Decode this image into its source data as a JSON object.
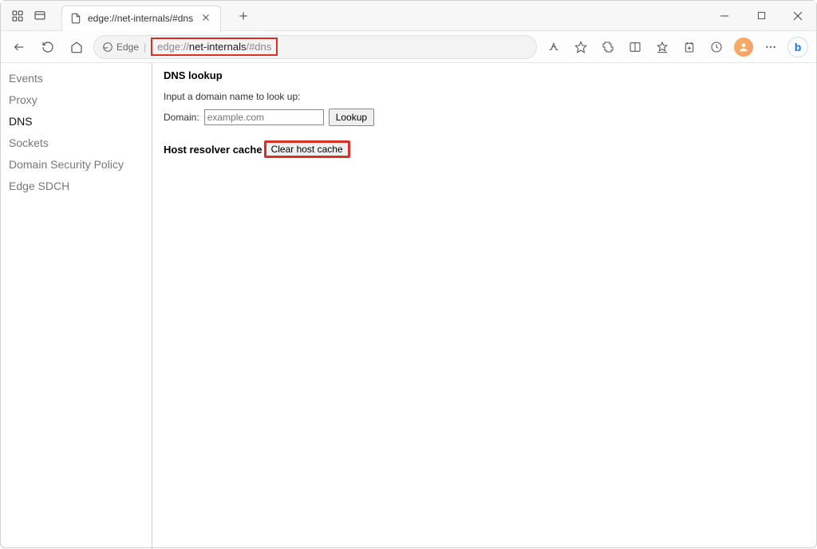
{
  "window": {
    "tab_title": "edge://net-internals/#dns"
  },
  "toolbar": {
    "edge_label": "Edge",
    "url_scheme": "edge://",
    "url_bold": "net-internals",
    "url_hash": "/#dns"
  },
  "sidebar": {
    "items": [
      {
        "label": "Events",
        "active": false
      },
      {
        "label": "Proxy",
        "active": false
      },
      {
        "label": "DNS",
        "active": true
      },
      {
        "label": "Sockets",
        "active": false
      },
      {
        "label": "Domain Security Policy",
        "active": false
      },
      {
        "label": "Edge SDCH",
        "active": false
      }
    ]
  },
  "main": {
    "dns_lookup_title": "DNS lookup",
    "domain_instruction": "Input a domain name to look up:",
    "domain_label": "Domain:",
    "domain_placeholder": "example.com",
    "lookup_button": "Lookup",
    "cache_label": "Host resolver cache",
    "clear_cache_button": "Clear host cache"
  }
}
